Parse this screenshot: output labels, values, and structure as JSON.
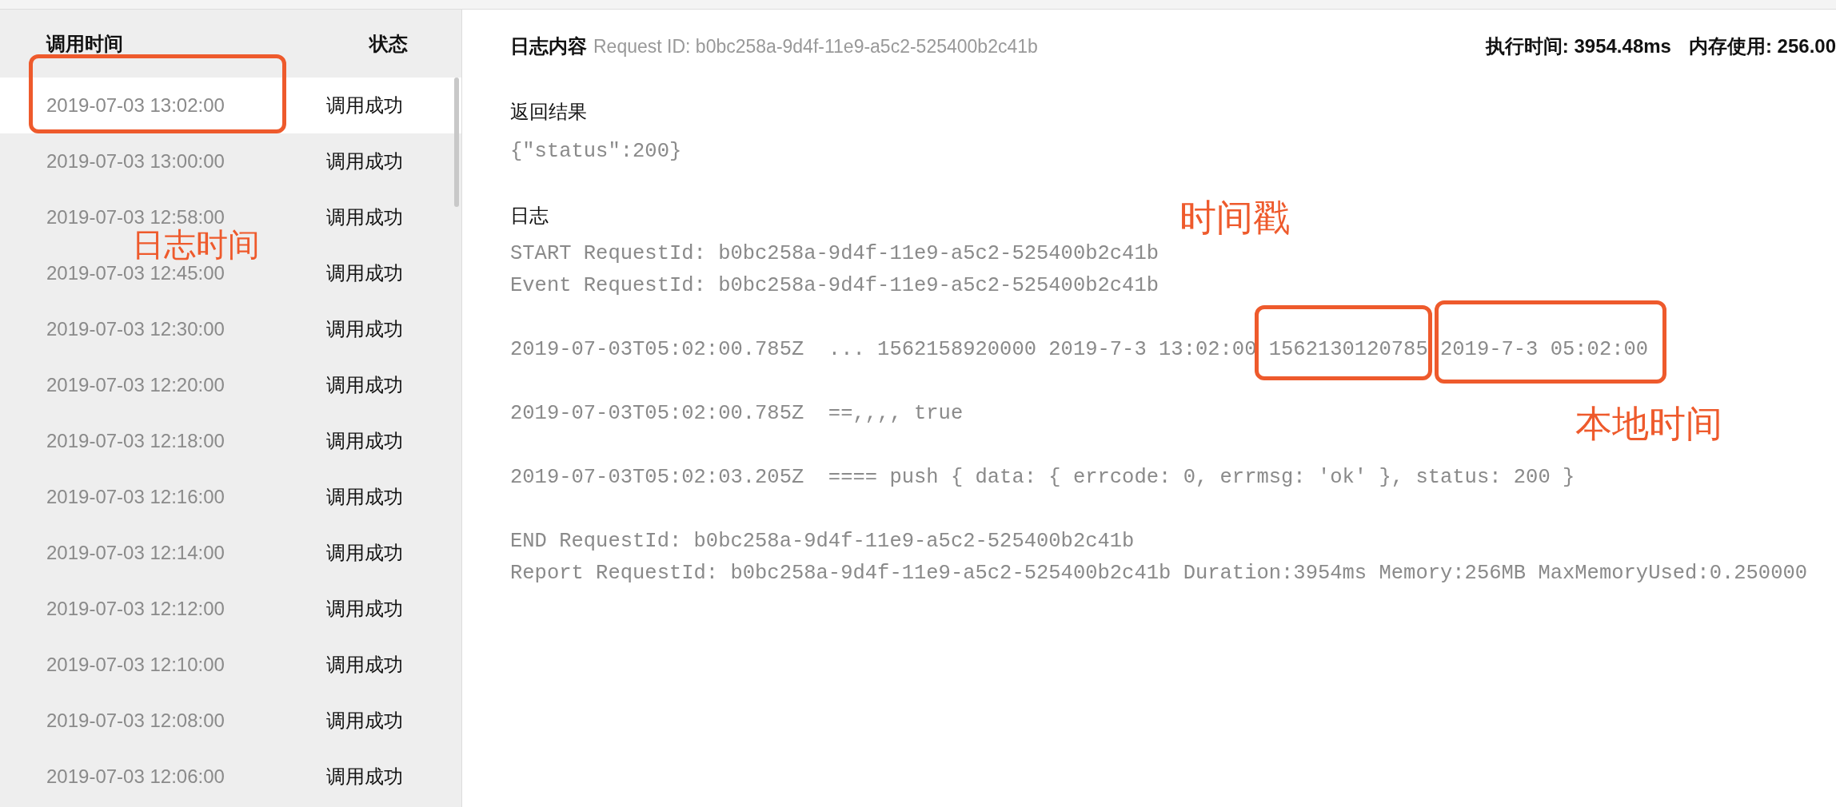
{
  "sidebar": {
    "columns": [
      "调用时间",
      "状态"
    ],
    "rows": [
      {
        "time": "2019-07-03 13:02:00",
        "status": "调用成功",
        "selected": true
      },
      {
        "time": "2019-07-03 13:00:00",
        "status": "调用成功",
        "selected": false
      },
      {
        "time": "2019-07-03 12:58:00",
        "status": "调用成功",
        "selected": false
      },
      {
        "time": "2019-07-03 12:45:00",
        "status": "调用成功",
        "selected": false
      },
      {
        "time": "2019-07-03 12:30:00",
        "status": "调用成功",
        "selected": false
      },
      {
        "time": "2019-07-03 12:20:00",
        "status": "调用成功",
        "selected": false
      },
      {
        "time": "2019-07-03 12:18:00",
        "status": "调用成功",
        "selected": false
      },
      {
        "time": "2019-07-03 12:16:00",
        "status": "调用成功",
        "selected": false
      },
      {
        "time": "2019-07-03 12:14:00",
        "status": "调用成功",
        "selected": false
      },
      {
        "time": "2019-07-03 12:12:00",
        "status": "调用成功",
        "selected": false
      },
      {
        "time": "2019-07-03 12:10:00",
        "status": "调用成功",
        "selected": false
      },
      {
        "time": "2019-07-03 12:08:00",
        "status": "调用成功",
        "selected": false
      },
      {
        "time": "2019-07-03 12:06:00",
        "status": "调用成功",
        "selected": false
      }
    ]
  },
  "detail": {
    "title": "日志内容",
    "request_id": "Request ID: b0bc258a-9d4f-11e9-a5c2-525400b2c41b",
    "stats": [
      "执行时间: 3954.48ms",
      "内存使用: 256.00"
    ],
    "result_label": "返回结果",
    "result": "{\"status\":200}",
    "log_label": "日志",
    "log_blocks": [
      [
        "START RequestId: b0bc258a-9d4f-11e9-a5c2-525400b2c41b",
        "Event RequestId: b0bc258a-9d4f-11e9-a5c2-525400b2c41b"
      ],
      [
        "2019-07-03T05:02:00.785Z  ... 1562158920000 2019-7-3 13:02:00 1562130120785 2019-7-3 05:02:00"
      ],
      [
        "2019-07-03T05:02:00.785Z  ==,,,, true"
      ],
      [
        "2019-07-03T05:02:03.205Z  ==== push { data: { errcode: 0, errmsg: 'ok' }, status: 200 }"
      ],
      [
        "END RequestId: b0bc258a-9d4f-11e9-a5c2-525400b2c41b",
        "Report RequestId: b0bc258a-9d4f-11e9-a5c2-525400b2c41b Duration:3954ms Memory:256MB MaxMemoryUsed:0.250000"
      ]
    ]
  },
  "annotations": {
    "labels": [
      "日志时间",
      "时间戳",
      "本地时间"
    ]
  }
}
